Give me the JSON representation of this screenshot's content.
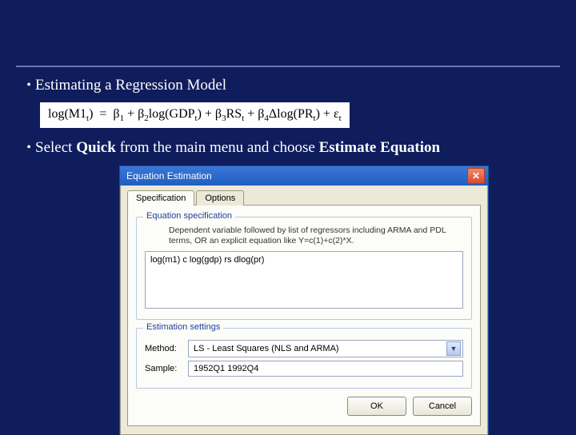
{
  "bullets": {
    "b1": "Estimating a Regression Model",
    "b2_pre": "Select ",
    "b2_bold1": "Quick",
    "b2_mid": " from the main menu and choose ",
    "b2_bold2": "Estimate Equation"
  },
  "equation": "log(M1_t) = β₁ + β₂log(GDP_t) + β₃RS_t + β₄Δlog(PR_t) + ε_t",
  "dialog": {
    "title": "Equation Estimation",
    "tabs": {
      "specification": "Specification",
      "options": "Options"
    },
    "group_spec": {
      "legend": "Equation specification",
      "help": "Dependent variable followed by list of regressors including ARMA and PDL terms, OR an explicit equation like Y=c(1)+c(2)*X.",
      "value": "log(m1) c log(gdp) rs dlog(pr)"
    },
    "group_est": {
      "legend": "Estimation settings",
      "method_label": "Method:",
      "method_value": "LS - Least Squares (NLS and ARMA)",
      "sample_label": "Sample:",
      "sample_value": "1952Q1 1992Q4"
    },
    "buttons": {
      "ok": "OK",
      "cancel": "Cancel"
    }
  }
}
